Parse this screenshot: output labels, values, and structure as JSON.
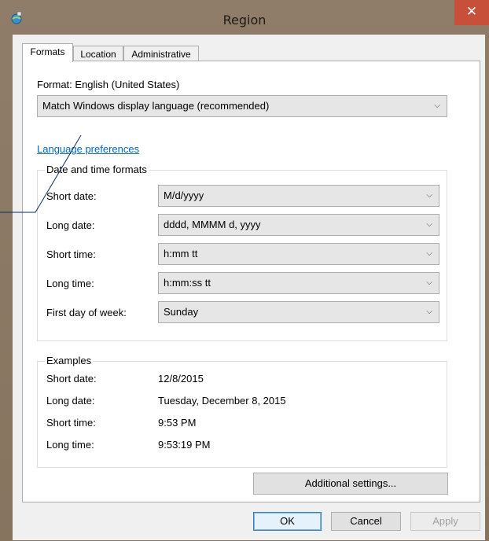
{
  "window": {
    "title": "Region",
    "close_glyph": "✕"
  },
  "tabs": [
    {
      "label": "Formats",
      "active": true
    },
    {
      "label": "Location",
      "active": false
    },
    {
      "label": "Administrative",
      "active": false
    }
  ],
  "formats": {
    "format_label": "Format: English (United States)",
    "format_value": "Match Windows display language (recommended)",
    "language_link": "Language preferences",
    "date_time_group": "Date and time formats",
    "rows": [
      {
        "label": "Short date:",
        "value": "M/d/yyyy"
      },
      {
        "label": "Long date:",
        "value": "dddd, MMMM d, yyyy"
      },
      {
        "label": "Short time:",
        "value": "h:mm tt"
      },
      {
        "label": "Long time:",
        "value": "h:mm:ss tt"
      },
      {
        "label": "First day of week:",
        "value": "Sunday"
      }
    ],
    "examples_group": "Examples",
    "examples": [
      {
        "label": "Short date:",
        "value": "12/8/2015"
      },
      {
        "label": "Long date:",
        "value": "Tuesday, December 8, 2015"
      },
      {
        "label": "Short time:",
        "value": "9:53 PM"
      },
      {
        "label": "Long time:",
        "value": "9:53:19 PM"
      }
    ],
    "additional_settings": "Additional settings..."
  },
  "buttons": {
    "ok": "OK",
    "cancel": "Cancel",
    "apply": "Apply"
  },
  "icons": {
    "dropdown": "chevron-down-icon",
    "app": "region-globe-icon"
  },
  "colors": {
    "frame": "#8b7965",
    "close": "#c7503b",
    "link": "#0066cc"
  }
}
